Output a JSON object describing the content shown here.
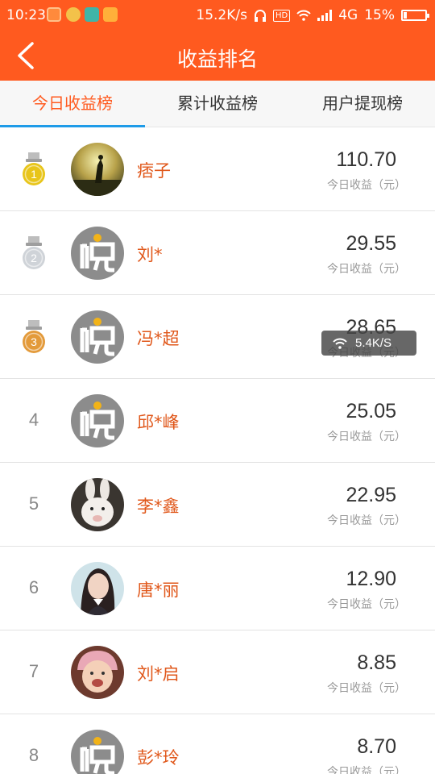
{
  "status_bar": {
    "time": "10:23",
    "net_speed": "15.2K/s",
    "hd": "HD",
    "network": "4G",
    "battery": "15%",
    "battery_level": 0.15
  },
  "header": {
    "title": "收益排名",
    "back_icon": "chevron-left-icon"
  },
  "tabs": [
    {
      "label": "今日收益榜",
      "active": true
    },
    {
      "label": "累计收益榜",
      "active": false
    },
    {
      "label": "用户提现榜",
      "active": false
    }
  ],
  "rankings": [
    {
      "rank": "1",
      "medal": "gold",
      "name": "痞子",
      "amount": "110.70",
      "label": "今日收益（元）",
      "avatar": "photo-silhouette"
    },
    {
      "rank": "2",
      "medal": "silver",
      "name": "刘*",
      "amount": "29.55",
      "label": "今日收益（元）",
      "avatar": "default-yue"
    },
    {
      "rank": "3",
      "medal": "bronze",
      "name": "冯*超",
      "amount": "28.65",
      "label": "今日收益（元）",
      "avatar": "default-yue"
    },
    {
      "rank": "4",
      "medal": "",
      "name": "邱*峰",
      "amount": "25.05",
      "label": "今日收益（元）",
      "avatar": "default-yue"
    },
    {
      "rank": "5",
      "medal": "",
      "name": "李*鑫",
      "amount": "22.95",
      "label": "今日收益（元）",
      "avatar": "photo-rabbit"
    },
    {
      "rank": "6",
      "medal": "",
      "name": "唐*丽",
      "amount": "12.90",
      "label": "今日收益（元）",
      "avatar": "photo-girl"
    },
    {
      "rank": "7",
      "medal": "",
      "name": "刘*启",
      "amount": "8.85",
      "label": "今日收益（元）",
      "avatar": "photo-baby"
    },
    {
      "rank": "8",
      "medal": "",
      "name": "彭*玲",
      "amount": "8.70",
      "label": "今日收益（元）",
      "avatar": "default-yue"
    }
  ],
  "toast": {
    "speed": "5.4K/S",
    "icon": "wifi-icon"
  },
  "colors": {
    "brand": "#ff5a1f",
    "tab_indicator": "#1e9be8",
    "name_text": "#e0571a",
    "gold": "#e8c51a",
    "silver": "#cfd3d8",
    "bronze": "#e39a3a"
  }
}
